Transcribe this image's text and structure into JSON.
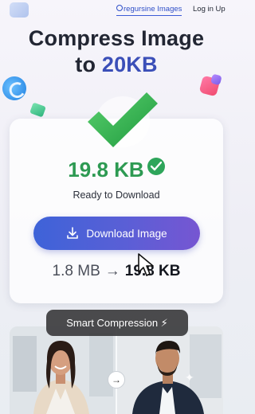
{
  "nav": {
    "search_label": "regursine Images",
    "login_label": "Log in Up"
  },
  "hero": {
    "title_line1": "Compress Image",
    "title_line2_prefix": "to ",
    "title_line2_accent": "20KB"
  },
  "result": {
    "size": "19.8 KB",
    "status": "Ready to Download",
    "download_label": "Download Image",
    "original_size": "1.8 MB",
    "arrow": "→",
    "compressed_size": "19.8 KB"
  },
  "preview": {
    "badge_label": "Smart Compression ⚡",
    "swap_icon": "→"
  },
  "colors": {
    "success": "#2d9a52",
    "accent": "#3b4fb8",
    "button_start": "#3e63d8",
    "button_end": "#7656d2"
  },
  "icons": [
    "logo-icon",
    "search-icon",
    "checkmark-icon",
    "check-badge-icon",
    "download-icon",
    "cursor-icon",
    "arrow-right-icon",
    "sparkle-icon"
  ]
}
